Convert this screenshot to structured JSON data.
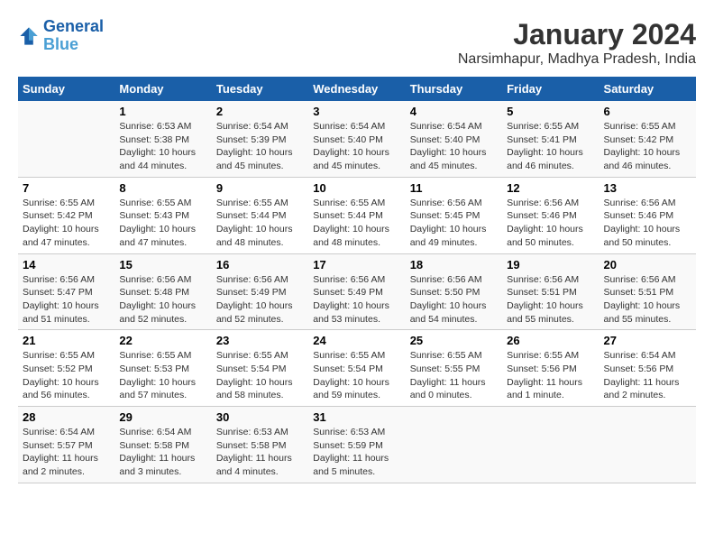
{
  "header": {
    "logo_line1": "General",
    "logo_line2": "Blue",
    "title": "January 2024",
    "subtitle": "Narsimhapur, Madhya Pradesh, India"
  },
  "days_of_week": [
    "Sunday",
    "Monday",
    "Tuesday",
    "Wednesday",
    "Thursday",
    "Friday",
    "Saturday"
  ],
  "weeks": [
    [
      {
        "day": "",
        "info": ""
      },
      {
        "day": "1",
        "info": "Sunrise: 6:53 AM\nSunset: 5:38 PM\nDaylight: 10 hours\nand 44 minutes."
      },
      {
        "day": "2",
        "info": "Sunrise: 6:54 AM\nSunset: 5:39 PM\nDaylight: 10 hours\nand 45 minutes."
      },
      {
        "day": "3",
        "info": "Sunrise: 6:54 AM\nSunset: 5:40 PM\nDaylight: 10 hours\nand 45 minutes."
      },
      {
        "day": "4",
        "info": "Sunrise: 6:54 AM\nSunset: 5:40 PM\nDaylight: 10 hours\nand 45 minutes."
      },
      {
        "day": "5",
        "info": "Sunrise: 6:55 AM\nSunset: 5:41 PM\nDaylight: 10 hours\nand 46 minutes."
      },
      {
        "day": "6",
        "info": "Sunrise: 6:55 AM\nSunset: 5:42 PM\nDaylight: 10 hours\nand 46 minutes."
      }
    ],
    [
      {
        "day": "7",
        "info": "Sunrise: 6:55 AM\nSunset: 5:42 PM\nDaylight: 10 hours\nand 47 minutes."
      },
      {
        "day": "8",
        "info": "Sunrise: 6:55 AM\nSunset: 5:43 PM\nDaylight: 10 hours\nand 47 minutes."
      },
      {
        "day": "9",
        "info": "Sunrise: 6:55 AM\nSunset: 5:44 PM\nDaylight: 10 hours\nand 48 minutes."
      },
      {
        "day": "10",
        "info": "Sunrise: 6:55 AM\nSunset: 5:44 PM\nDaylight: 10 hours\nand 48 minutes."
      },
      {
        "day": "11",
        "info": "Sunrise: 6:56 AM\nSunset: 5:45 PM\nDaylight: 10 hours\nand 49 minutes."
      },
      {
        "day": "12",
        "info": "Sunrise: 6:56 AM\nSunset: 5:46 PM\nDaylight: 10 hours\nand 50 minutes."
      },
      {
        "day": "13",
        "info": "Sunrise: 6:56 AM\nSunset: 5:46 PM\nDaylight: 10 hours\nand 50 minutes."
      }
    ],
    [
      {
        "day": "14",
        "info": "Sunrise: 6:56 AM\nSunset: 5:47 PM\nDaylight: 10 hours\nand 51 minutes."
      },
      {
        "day": "15",
        "info": "Sunrise: 6:56 AM\nSunset: 5:48 PM\nDaylight: 10 hours\nand 52 minutes."
      },
      {
        "day": "16",
        "info": "Sunrise: 6:56 AM\nSunset: 5:49 PM\nDaylight: 10 hours\nand 52 minutes."
      },
      {
        "day": "17",
        "info": "Sunrise: 6:56 AM\nSunset: 5:49 PM\nDaylight: 10 hours\nand 53 minutes."
      },
      {
        "day": "18",
        "info": "Sunrise: 6:56 AM\nSunset: 5:50 PM\nDaylight: 10 hours\nand 54 minutes."
      },
      {
        "day": "19",
        "info": "Sunrise: 6:56 AM\nSunset: 5:51 PM\nDaylight: 10 hours\nand 55 minutes."
      },
      {
        "day": "20",
        "info": "Sunrise: 6:56 AM\nSunset: 5:51 PM\nDaylight: 10 hours\nand 55 minutes."
      }
    ],
    [
      {
        "day": "21",
        "info": "Sunrise: 6:55 AM\nSunset: 5:52 PM\nDaylight: 10 hours\nand 56 minutes."
      },
      {
        "day": "22",
        "info": "Sunrise: 6:55 AM\nSunset: 5:53 PM\nDaylight: 10 hours\nand 57 minutes."
      },
      {
        "day": "23",
        "info": "Sunrise: 6:55 AM\nSunset: 5:54 PM\nDaylight: 10 hours\nand 58 minutes."
      },
      {
        "day": "24",
        "info": "Sunrise: 6:55 AM\nSunset: 5:54 PM\nDaylight: 10 hours\nand 59 minutes."
      },
      {
        "day": "25",
        "info": "Sunrise: 6:55 AM\nSunset: 5:55 PM\nDaylight: 11 hours\nand 0 minutes."
      },
      {
        "day": "26",
        "info": "Sunrise: 6:55 AM\nSunset: 5:56 PM\nDaylight: 11 hours\nand 1 minute."
      },
      {
        "day": "27",
        "info": "Sunrise: 6:54 AM\nSunset: 5:56 PM\nDaylight: 11 hours\nand 2 minutes."
      }
    ],
    [
      {
        "day": "28",
        "info": "Sunrise: 6:54 AM\nSunset: 5:57 PM\nDaylight: 11 hours\nand 2 minutes."
      },
      {
        "day": "29",
        "info": "Sunrise: 6:54 AM\nSunset: 5:58 PM\nDaylight: 11 hours\nand 3 minutes."
      },
      {
        "day": "30",
        "info": "Sunrise: 6:53 AM\nSunset: 5:58 PM\nDaylight: 11 hours\nand 4 minutes."
      },
      {
        "day": "31",
        "info": "Sunrise: 6:53 AM\nSunset: 5:59 PM\nDaylight: 11 hours\nand 5 minutes."
      },
      {
        "day": "",
        "info": ""
      },
      {
        "day": "",
        "info": ""
      },
      {
        "day": "",
        "info": ""
      }
    ]
  ]
}
